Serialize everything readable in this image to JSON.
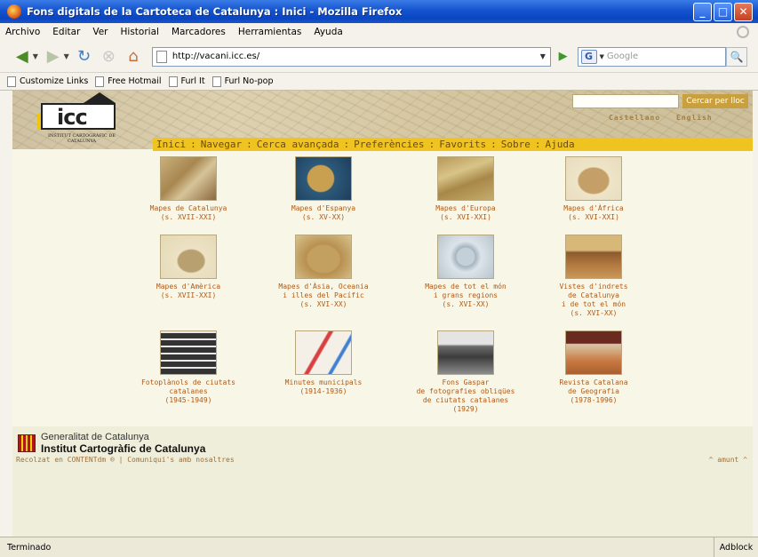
{
  "window": {
    "title": "Fons digitals de la Cartoteca de Catalunya : Inici - Mozilla Firefox"
  },
  "menu": [
    "Archivo",
    "Editar",
    "Ver",
    "Historial",
    "Marcadores",
    "Herramientas",
    "Ayuda"
  ],
  "nav": {
    "url": "http://vacani.icc.es/",
    "search_placeholder": "Google"
  },
  "bookmarks": [
    "Customize Links",
    "Free Hotmail",
    "Furl It",
    "Furl No-pop"
  ],
  "site": {
    "logo_text": "icc",
    "logo_sub": "INSTITUT CARTOGRÀFIC DE CATALUNYA",
    "search_button": "Cercar per lloc",
    "lang_ca": "Castellano",
    "lang_en": "English",
    "nav_items": [
      "Inici",
      "Navegar",
      "Cerca avançada",
      "Preferències",
      "Favorits",
      "Sobre",
      "Ajuda"
    ]
  },
  "collections": [
    {
      "label": "Mapes de Catalunya\n(s. XVII-XXI)",
      "icon": "map-catalunya-thumb"
    },
    {
      "label": "Mapes d'Espanya\n(s. XV-XX)",
      "icon": "map-espanya-thumb"
    },
    {
      "label": "Mapes d'Europa\n(s. XVI-XXI)",
      "icon": "map-europa-thumb"
    },
    {
      "label": "Mapes d'Àfrica\n(s. XVI-XXI)",
      "icon": "map-africa-thumb"
    },
    {
      "label": "Mapes d'Amèrica\n(s. XVII-XXI)",
      "icon": "map-america-thumb"
    },
    {
      "label": "Mapes d'Àsia, Oceania\ni illes del Pacífic\n(s. XVI-XX)",
      "icon": "map-asia-thumb"
    },
    {
      "label": "Mapes de tot el món\ni grans regions\n(s. XVI-XX)",
      "icon": "map-mon-thumb"
    },
    {
      "label": "Vistes d'indrets\nde Catalunya\ni de tot el món\n(s. XVI-XX)",
      "icon": "vistes-thumb"
    },
    {
      "label": "Fotoplànols de ciutats\ncatalanes\n(1945-1949)",
      "icon": "fotoplanols-thumb"
    },
    {
      "label": "Minutes municipals\n(1914-1936)",
      "icon": "minutes-thumb"
    },
    {
      "label": "Fons Gaspar\nde fotografies obliqües\nde ciutats catalanes\n(1929)",
      "icon": "fons-gaspar-thumb"
    },
    {
      "label": "Revista Catalana\nde Geografia\n(1978-1996)",
      "icon": "revista-thumb"
    }
  ],
  "footer": {
    "gen_line1": "Generalitat de Catalunya",
    "gen_line2": "Institut Cartogràfic de Catalunya",
    "powered": "Recolzat en CONTENTdm ® | Comuniqui's amb nosaltres",
    "top_link": "^ amunt ^"
  },
  "status": {
    "text": "Terminado",
    "adblock": "Adblock"
  }
}
